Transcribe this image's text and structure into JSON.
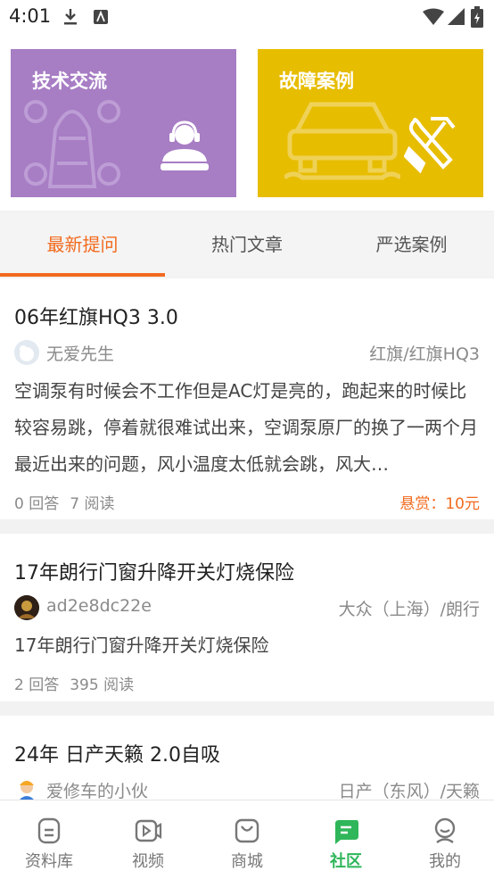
{
  "status_bar": {
    "time": "4:01"
  },
  "banners": [
    {
      "title": "技术交流"
    },
    {
      "title": "故障案例"
    }
  ],
  "tabs": [
    {
      "label": "最新提问",
      "active": true
    },
    {
      "label": "热门文章",
      "active": false
    },
    {
      "label": "严选案例",
      "active": false
    }
  ],
  "posts": [
    {
      "title": "06年红旗HQ3 3.0",
      "user": "无爱先生",
      "category": "红旗/红旗HQ3",
      "body": "空调泵有时候会不工作但是AC灯是亮的，跑起来的时候比较容易跳，停着就很难试出来，空调泵原厂的换了一两个月最近出来的问题，风小温度太低就会跳，风大…",
      "answers": "0 回答",
      "reads": "7 阅读",
      "reward": "悬赏：10元"
    },
    {
      "title": "17年朗行门窗升降开关灯烧保险",
      "user": "ad2e8dc22e",
      "category": "大众（上海）/朗行",
      "body": "17年朗行门窗升降开关灯烧保险",
      "answers": "2 回答",
      "reads": "395 阅读"
    },
    {
      "title": "24年 日产天籁  2.0自吸",
      "user": "爱修车的小伙",
      "category": "日产（东风）/天籁"
    }
  ],
  "nav": [
    {
      "label": "资料库",
      "icon": "book-icon"
    },
    {
      "label": "视频",
      "icon": "video-icon"
    },
    {
      "label": "商城",
      "icon": "bag-icon"
    },
    {
      "label": "社区",
      "icon": "chat-icon",
      "active": true
    },
    {
      "label": "我的",
      "icon": "profile-icon"
    }
  ],
  "colors": {
    "accent": "#f26a1e",
    "nav_active": "#2fb65a",
    "card_purple": "#a77dc4",
    "card_yellow": "#e7bd00"
  }
}
